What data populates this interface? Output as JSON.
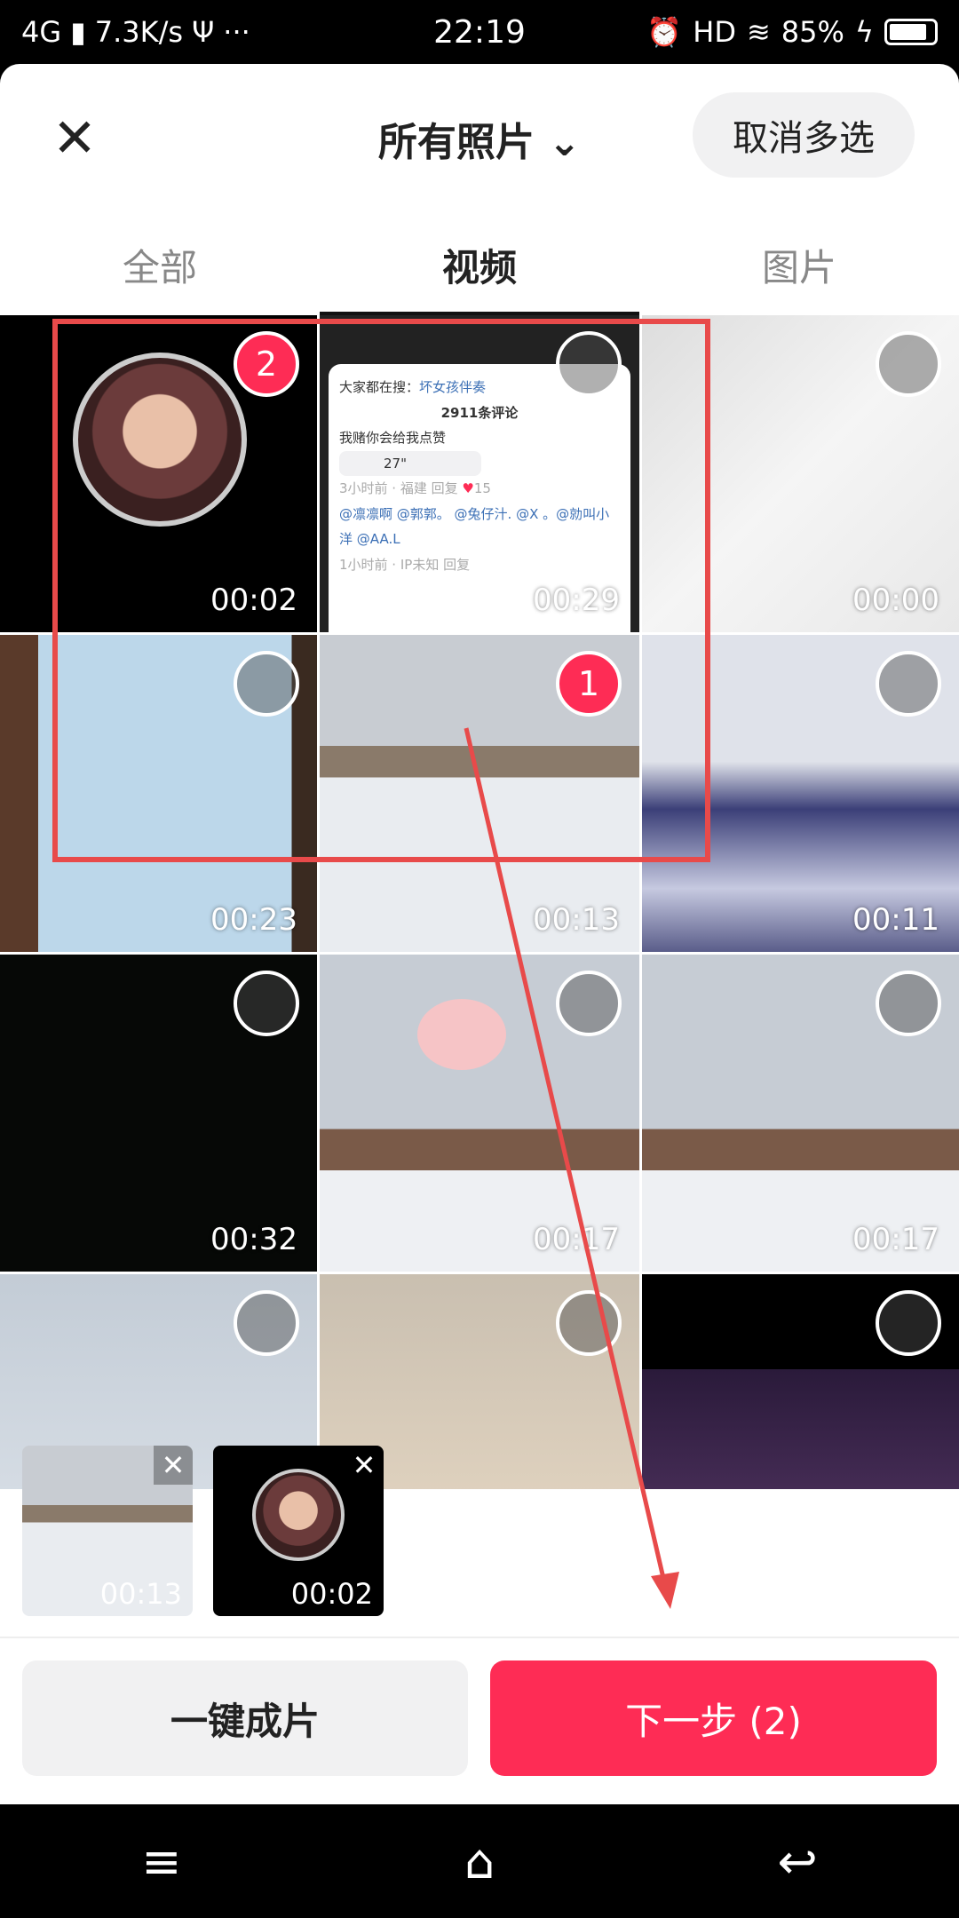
{
  "status_bar": {
    "network": "4G",
    "speed": "7.3K/s",
    "usb_icon": "usb-icon",
    "more": "···",
    "time": "22:19",
    "alarm_icon": "alarm-icon",
    "hd": "HD",
    "wifi_icon": "wifi-icon",
    "battery": "85%",
    "battery_level": 0.85
  },
  "header": {
    "close": "✕",
    "title": "所有照片",
    "dropdown_icon": "⌄",
    "cancel_multi": "取消多选"
  },
  "tabs": [
    {
      "label": "全部"
    },
    {
      "label": "视频",
      "active": true
    },
    {
      "label": "图片"
    }
  ],
  "grid": [
    {
      "duration": "00:02",
      "selected": "2"
    },
    {
      "duration": "00:29",
      "selected": "",
      "comment": {
        "trending_prefix": "大家都在搜：",
        "trending": "坏女孩伴奏",
        "count": "2911条评论",
        "text": "我赌你会给我点赞",
        "voice": "27\"",
        "meta": "3小时前 · 福建 回复",
        "likes": "15",
        "reply": "@凛凛啊 @郭郭。 @兔仔汁. @X 。@勍叫小洋 @AA.L",
        "reply_meta": "1小时前 · IP未知 回复"
      }
    },
    {
      "duration": "00:00",
      "selected": ""
    },
    {
      "duration": "00:23",
      "selected": ""
    },
    {
      "duration": "00:13",
      "selected": "1"
    },
    {
      "duration": "00:11",
      "selected": ""
    },
    {
      "duration": "00:32",
      "selected": ""
    },
    {
      "duration": "00:17",
      "selected": ""
    },
    {
      "duration": "00:17",
      "selected": ""
    },
    {
      "duration": "",
      "selected": ""
    },
    {
      "duration": "",
      "selected": ""
    },
    {
      "duration": "",
      "selected": ""
    }
  ],
  "selected_strip": [
    {
      "duration": "00:13",
      "remove": "✕"
    },
    {
      "duration": "00:02",
      "remove": "✕"
    }
  ],
  "footer": {
    "one_click": "一键成片",
    "next": "下一步 (2)"
  },
  "nav": {
    "menu": "≡",
    "home": "⌂",
    "back": "↩"
  },
  "colors": {
    "accent": "#fe2c55",
    "annotation": "#e84a4a"
  }
}
